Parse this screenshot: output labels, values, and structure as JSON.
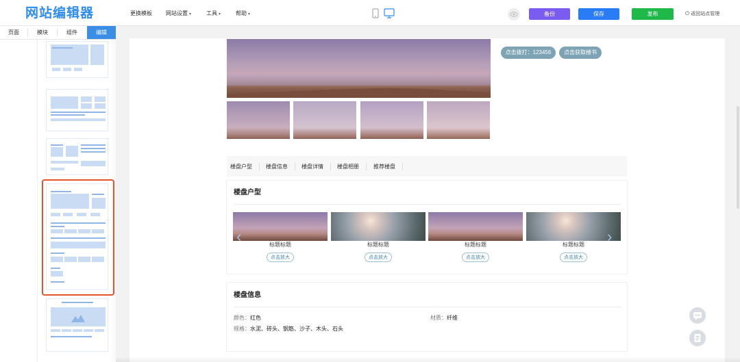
{
  "app": {
    "logo": "网站编辑器",
    "menu": [
      {
        "label": "更换模板",
        "caret": false
      },
      {
        "label": "网站设置",
        "caret": true
      },
      {
        "label": "工具",
        "caret": true
      },
      {
        "label": "帮助",
        "caret": true
      }
    ],
    "buttons": {
      "backup": "备份",
      "save": "保存",
      "publish": "发布"
    },
    "back_link": "返回站点管理",
    "colors": {
      "logo": "#2f8cf0",
      "backup": "#7b5cf0",
      "save": "#2a7cf6",
      "publish": "#1fb84a",
      "tab_active": "#3a8ee6",
      "selection": "#e3532c",
      "pill": "#7da3b4"
    }
  },
  "sidebar": {
    "tabs": [
      "页面",
      "模块",
      "组件",
      "编辑"
    ],
    "active_tab": "编辑"
  },
  "page": {
    "contact_buttons": [
      "点击拨打：123456",
      "点击获取楼书"
    ],
    "nav": [
      "楼盘户型",
      "楼盘信息",
      "楼盘详情",
      "楼盘相册",
      "推荐楼盘"
    ],
    "floor_plan": {
      "title": "楼盘户型",
      "items": [
        {
          "label": "标题标题",
          "button": "点击放大"
        },
        {
          "label": "标题标题",
          "button": "点击放大"
        },
        {
          "label": "标题标题",
          "button": "点击放大"
        },
        {
          "label": "标题标题",
          "button": "点击放大"
        }
      ]
    },
    "info": {
      "title": "楼盘信息",
      "color_key": "颜色：",
      "color_val": "红色",
      "material_key": "材质：",
      "material_val": "纤维",
      "spec_key": "规格：",
      "spec_val": "水泥、砖头、钢筋、沙子、木头、石头"
    }
  }
}
